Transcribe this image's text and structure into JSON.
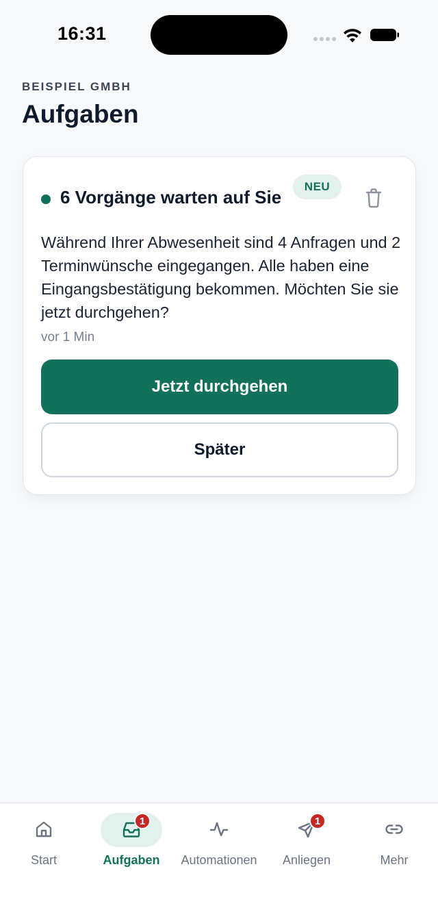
{
  "status_bar": {
    "time": "16:31"
  },
  "header": {
    "company": "BEISPIEL GMBH",
    "title": "Aufgaben"
  },
  "task_card": {
    "title": "6 Vorgänge warten auf Sie",
    "badge": "NEU",
    "body": "Während Ihrer Abwesenheit sind 4 Anfragen und 2 Terminwünsche eingegangen. Alle haben eine Eingangsbestätigung bekommen. Möchten Sie sie jetzt durchgehen?",
    "timestamp": "vor 1 Min",
    "primary_label": "Jetzt durchgehen",
    "secondary_label": "Später",
    "accent_color": "#12715a"
  },
  "bottom_nav": {
    "items": [
      {
        "label": "Start",
        "icon": "home-icon",
        "active": false
      },
      {
        "label": "Aufgaben",
        "icon": "inbox-icon",
        "active": true,
        "badge": "1"
      },
      {
        "label": "Automationen",
        "icon": "activity-icon",
        "active": false
      },
      {
        "label": "Anliegen",
        "icon": "send-icon",
        "active": false,
        "badge": "1"
      },
      {
        "label": "Mehr",
        "icon": "link-icon",
        "active": false
      }
    ]
  }
}
